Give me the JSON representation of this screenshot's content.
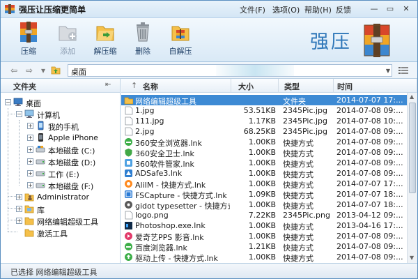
{
  "window": {
    "title": "强压让压缩更简单",
    "menus": [
      "文件(F)",
      "选项(O)",
      "帮助(H)",
      "反馈"
    ],
    "controls": {
      "minimize": "—",
      "restore": "▭",
      "close": "✕"
    }
  },
  "toolbar": {
    "buttons": [
      {
        "label": "压缩",
        "icon": "archive-icon",
        "enabled": true
      },
      {
        "label": "添加",
        "icon": "add-folder-icon",
        "enabled": false
      },
      {
        "label": "解压缩",
        "icon": "extract-folder-icon",
        "enabled": true
      },
      {
        "label": "删除",
        "icon": "trash-icon",
        "enabled": true
      },
      {
        "label": "自解压",
        "icon": "self-extract-icon",
        "enabled": true
      }
    ],
    "brand_text": "强压"
  },
  "address": {
    "back": "⇦",
    "forward": "⇨",
    "up": "up-folder-icon",
    "path": "桌面"
  },
  "tree": {
    "header": "文件夹",
    "pin": "⇤",
    "items": [
      {
        "label": "桌面",
        "icon": "desktop-icon",
        "expander": "−"
      },
      {
        "label": "计算机",
        "icon": "computer-icon",
        "expander": "−"
      },
      {
        "label": "我的手机",
        "icon": "phone-icon",
        "expander": "+"
      },
      {
        "label": "Apple iPhone",
        "icon": "phone-icon",
        "expander": "+"
      },
      {
        "label": "本地磁盘 (C:)",
        "icon": "drive-icon",
        "expander": "+"
      },
      {
        "label": "本地磁盘 (D:)",
        "icon": "drive-icon",
        "expander": "+"
      },
      {
        "label": "工作 (E:)",
        "icon": "drive-icon",
        "expander": "+"
      },
      {
        "label": "本地磁盘 (F:)",
        "icon": "drive-icon",
        "expander": "+"
      },
      {
        "label": "Administrator",
        "icon": "user-folder-icon",
        "expander": "+"
      },
      {
        "label": "库",
        "icon": "library-icon",
        "expander": "+"
      },
      {
        "label": "网络编辑超级工具",
        "icon": "folder-icon",
        "expander": "+"
      },
      {
        "label": "激活工具",
        "icon": "folder-icon",
        "expander": ""
      }
    ]
  },
  "filelist": {
    "columns": [
      "名称",
      "大小",
      "类型",
      "时间"
    ],
    "sort_arrow": "↑",
    "rows": [
      {
        "name": "网络编辑超级工具",
        "size": "",
        "type": "文件夹",
        "time": "2014-07-07 17:...",
        "icon": "folder-icon",
        "selected": true
      },
      {
        "name": "1.jpg",
        "size": "53.51KB",
        "type": "2345Pic.jpg",
        "time": "2014-07-08 09:...",
        "icon": "image-file-icon",
        "selected": false
      },
      {
        "name": "111.jpg",
        "size": "1.17KB",
        "type": "2345Pic.jpg",
        "time": "2014-07-08 10:...",
        "icon": "image-file-icon",
        "selected": false
      },
      {
        "name": "2.jpg",
        "size": "68.25KB",
        "type": "2345Pic.jpg",
        "time": "2014-07-08 09:...",
        "icon": "image-file-icon",
        "selected": false
      },
      {
        "name": "360安全浏览器.lnk",
        "size": "1.00KB",
        "type": "快捷方式",
        "time": "2014-07-08 09:...",
        "icon": "browser-icon",
        "selected": false
      },
      {
        "name": "360安全卫士.lnk",
        "size": "1.00KB",
        "type": "快捷方式",
        "time": "2014-07-08 09:...",
        "icon": "shield-icon",
        "selected": false
      },
      {
        "name": "360软件管家.lnk",
        "size": "1.00KB",
        "type": "快捷方式",
        "time": "2014-07-08 09:...",
        "icon": "app-manager-icon",
        "selected": false
      },
      {
        "name": "ADSafe3.lnk",
        "size": "1.00KB",
        "type": "快捷方式",
        "time": "2014-07-08 09:...",
        "icon": "adsafe-icon",
        "selected": false
      },
      {
        "name": "AliIM - 快捷方式.lnk",
        "size": "1.00KB",
        "type": "快捷方式",
        "time": "2014-07-07 17:...",
        "icon": "chat-icon",
        "selected": false
      },
      {
        "name": "FSCapture - 快捷方式.lnk",
        "size": "1.09KB",
        "type": "快捷方式",
        "time": "2014-07-07 18:...",
        "icon": "capture-icon",
        "selected": false
      },
      {
        "name": "gidot typesetter - 快捷方式...",
        "size": "1.00KB",
        "type": "快捷方式",
        "time": "2014-07-07 18:...",
        "icon": "typesetter-icon",
        "selected": false
      },
      {
        "name": "logo.png",
        "size": "7.22KB",
        "type": "2345Pic.png",
        "time": "2013-04-12 09:...",
        "icon": "image-file-icon",
        "selected": false
      },
      {
        "name": "Photoshop.exe.lnk",
        "size": "1.00KB",
        "type": "快捷方式",
        "time": "2013-04-16 17:...",
        "icon": "photoshop-icon",
        "selected": false
      },
      {
        "name": "爱奇艺PPS 影音.lnk",
        "size": "1.00KB",
        "type": "快捷方式",
        "time": "2014-07-08 09:...",
        "icon": "video-player-icon",
        "selected": false
      },
      {
        "name": "百度浏览器.lnk",
        "size": "1.21KB",
        "type": "快捷方式",
        "time": "2014-07-08 09:...",
        "icon": "browser-icon",
        "selected": false
      },
      {
        "name": "驱动上传 - 快捷方式.lnk",
        "size": "1.00KB",
        "type": "快捷方式",
        "time": "2014-07-08 09:...",
        "icon": "upload-icon",
        "selected": false
      }
    ]
  },
  "status": {
    "text": "已选择 网络编辑超级工具"
  },
  "colors": {
    "accent": "#2f77b9",
    "selection": "#3d8ad4",
    "border": "#5a8fc0"
  }
}
